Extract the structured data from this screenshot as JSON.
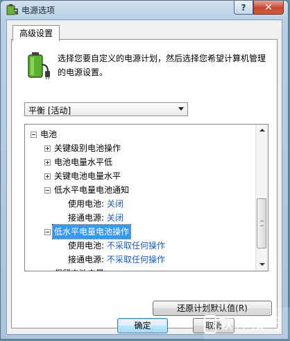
{
  "window": {
    "title": "电源选项",
    "help_glyph": "?",
    "close_glyph": "✕",
    "icon": "power-options-icon"
  },
  "tab": {
    "label": "高级设置"
  },
  "description": "选择您要自定义的电源计划，然后选择您希望计算机管理的电源设置。",
  "plan_select": {
    "value": "平衡 [活动]"
  },
  "tree": {
    "rows": [
      {
        "label": "电池",
        "expander": "minus",
        "value": ""
      },
      {
        "label": "关键级别电池操作",
        "expander": "plus",
        "value": ""
      },
      {
        "label": "电池电量水平低",
        "expander": "plus",
        "value": ""
      },
      {
        "label": "关键电池电量水平",
        "expander": "plus",
        "value": ""
      },
      {
        "label": "低水平电量电池通知",
        "expander": "minus",
        "value": ""
      },
      {
        "label": "使用电池:",
        "expander": "none",
        "value": "关闭"
      },
      {
        "label": "接通电源:",
        "expander": "none",
        "value": "关闭"
      },
      {
        "label": "低水平电量电池操作",
        "expander": "minus",
        "value": "",
        "selected": true
      },
      {
        "label": "使用电池:",
        "expander": "none",
        "value": "不采取任何操作"
      },
      {
        "label": "接通电源:",
        "expander": "none",
        "value": "不采取任何操作"
      },
      {
        "label": "保留电池电量",
        "expander": "plus",
        "value": ""
      }
    ]
  },
  "buttons": {
    "restore": "还原计划默认值(R)",
    "ok": "确定",
    "cancel": "取消"
  },
  "watermark": {
    "text": "软件技巧"
  }
}
